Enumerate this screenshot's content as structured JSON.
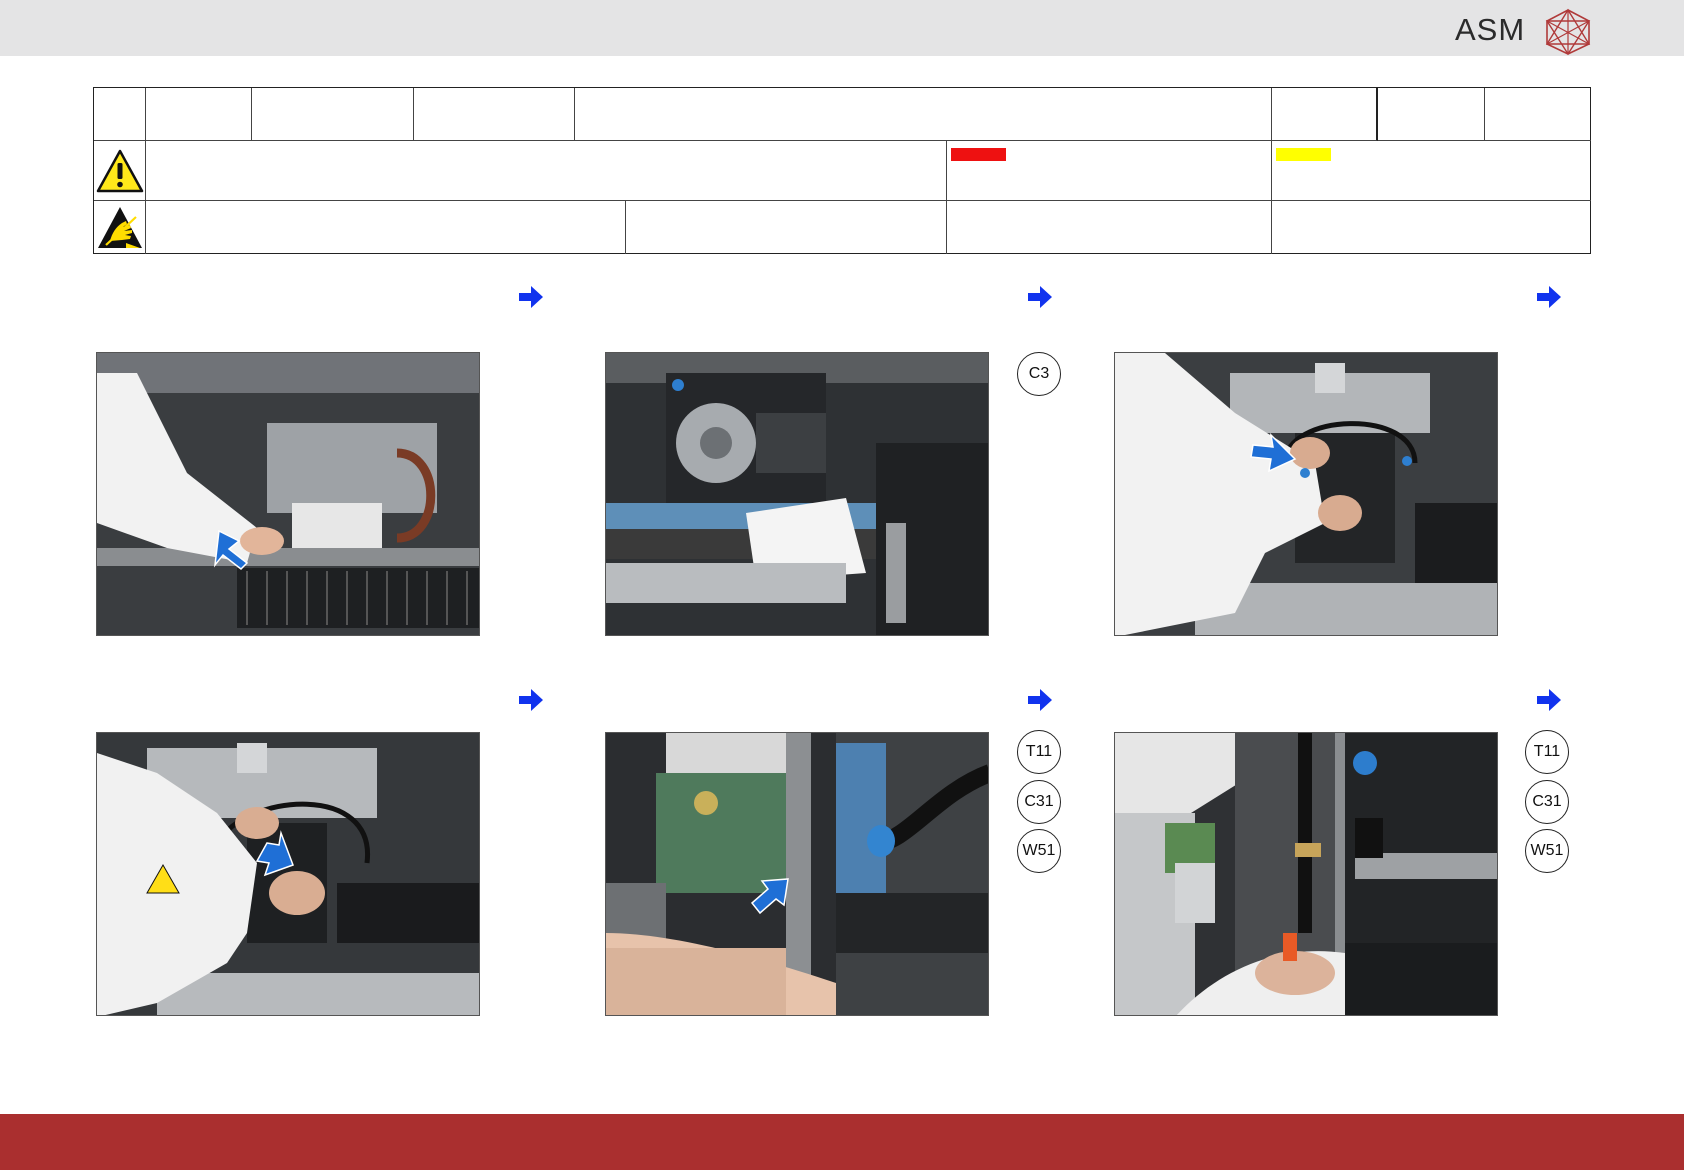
{
  "header": {
    "brand": "ASM"
  },
  "colors": {
    "brand_red": "#aa2f2f",
    "header_bg": "#e4e4e5",
    "danger_swatch": "#ee1111",
    "caution_swatch": "#ffff00",
    "arrow_blue": "#1133ee",
    "pointer_arrow": "#1f6fd6"
  },
  "icons": {
    "warning": "warning-triangle-icon",
    "esd": "esd-hand-icon",
    "next": "next-arrow-icon",
    "pointer": "pointer-arrow-icon"
  },
  "steps": [
    {
      "badges": []
    },
    {
      "badges": [
        "C3"
      ]
    },
    {
      "badges": []
    },
    {
      "badges": []
    },
    {
      "badges": [
        "T11",
        "C31",
        "W51"
      ]
    },
    {
      "badges": [
        "T11",
        "C31",
        "W51"
      ]
    }
  ]
}
